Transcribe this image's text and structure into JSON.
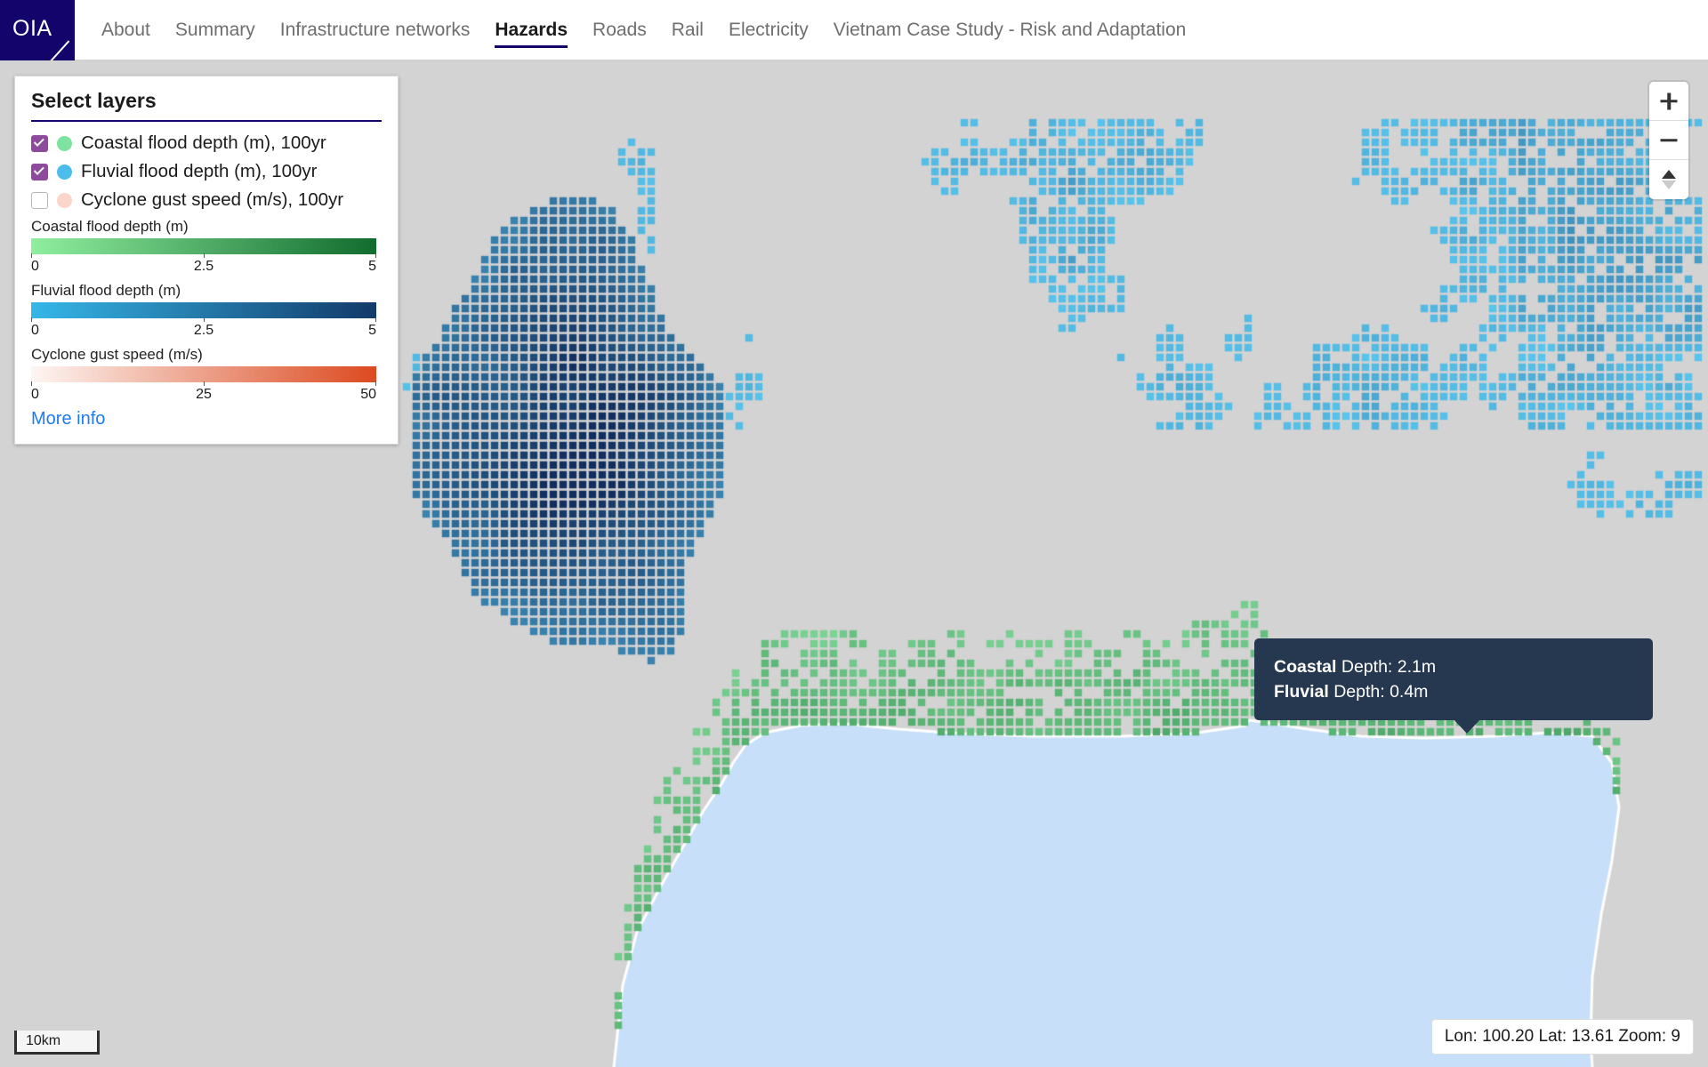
{
  "header": {
    "logo_text": "OIA",
    "nav_items": [
      {
        "label": "About",
        "active": false
      },
      {
        "label": "Summary",
        "active": false
      },
      {
        "label": "Infrastructure networks",
        "active": false
      },
      {
        "label": "Hazards",
        "active": true
      },
      {
        "label": "Roads",
        "active": false
      },
      {
        "label": "Rail",
        "active": false
      },
      {
        "label": "Electricity",
        "active": false
      },
      {
        "label": "Vietnam Case Study - Risk and Adaptation",
        "active": false
      }
    ]
  },
  "legend": {
    "title": "Select layers",
    "layers": [
      {
        "label": "Coastal flood depth (m), 100yr",
        "checked": true,
        "dot_color": "#7ee2a0"
      },
      {
        "label": "Fluvial flood depth (m), 100yr",
        "checked": true,
        "dot_color": "#4cbdeb"
      },
      {
        "label": "Cyclone gust speed (m/s), 100yr",
        "checked": false,
        "dot_color": "#fbd4ca"
      }
    ],
    "ramps": [
      {
        "label": "Coastal flood depth (m)",
        "ticks": [
          "0",
          "2.5",
          "5"
        ],
        "gradient_from": "#90ee9f",
        "gradient_to": "#116c2e"
      },
      {
        "label": "Fluvial flood depth (m)",
        "ticks": [
          "0",
          "2.5",
          "5"
        ],
        "gradient_from": "#35b7e8",
        "gradient_to": "#123a69"
      },
      {
        "label": "Cyclone gust speed (m/s)",
        "ticks": [
          "0",
          "25",
          "50"
        ],
        "gradient_from": "#fdf6f3",
        "gradient_to": "#dc4a20"
      }
    ],
    "more_info_label": "More info"
  },
  "map_controls": {
    "zoom_in_label": "+",
    "zoom_out_label": "−",
    "compass_label": "Reset bearing to north"
  },
  "tooltip": {
    "rows": [
      {
        "name": "Coastal",
        "value": "Depth: 2.1m"
      },
      {
        "name": "Fluvial",
        "value": "Depth: 0.4m"
      }
    ]
  },
  "status": {
    "coordinates": "Lon: 100.20 Lat: 13.61 Zoom: 9",
    "scale_label": "10km"
  },
  "map_colors": {
    "land": "#d3d3d3",
    "sea": "#c8dffa",
    "coastline": "#ffffff",
    "coastal_light": "#8ee6a6",
    "coastal_dark": "#0e6b2c",
    "fluvial_light": "#4cc4ee",
    "fluvial_dark": "#112f5e"
  }
}
